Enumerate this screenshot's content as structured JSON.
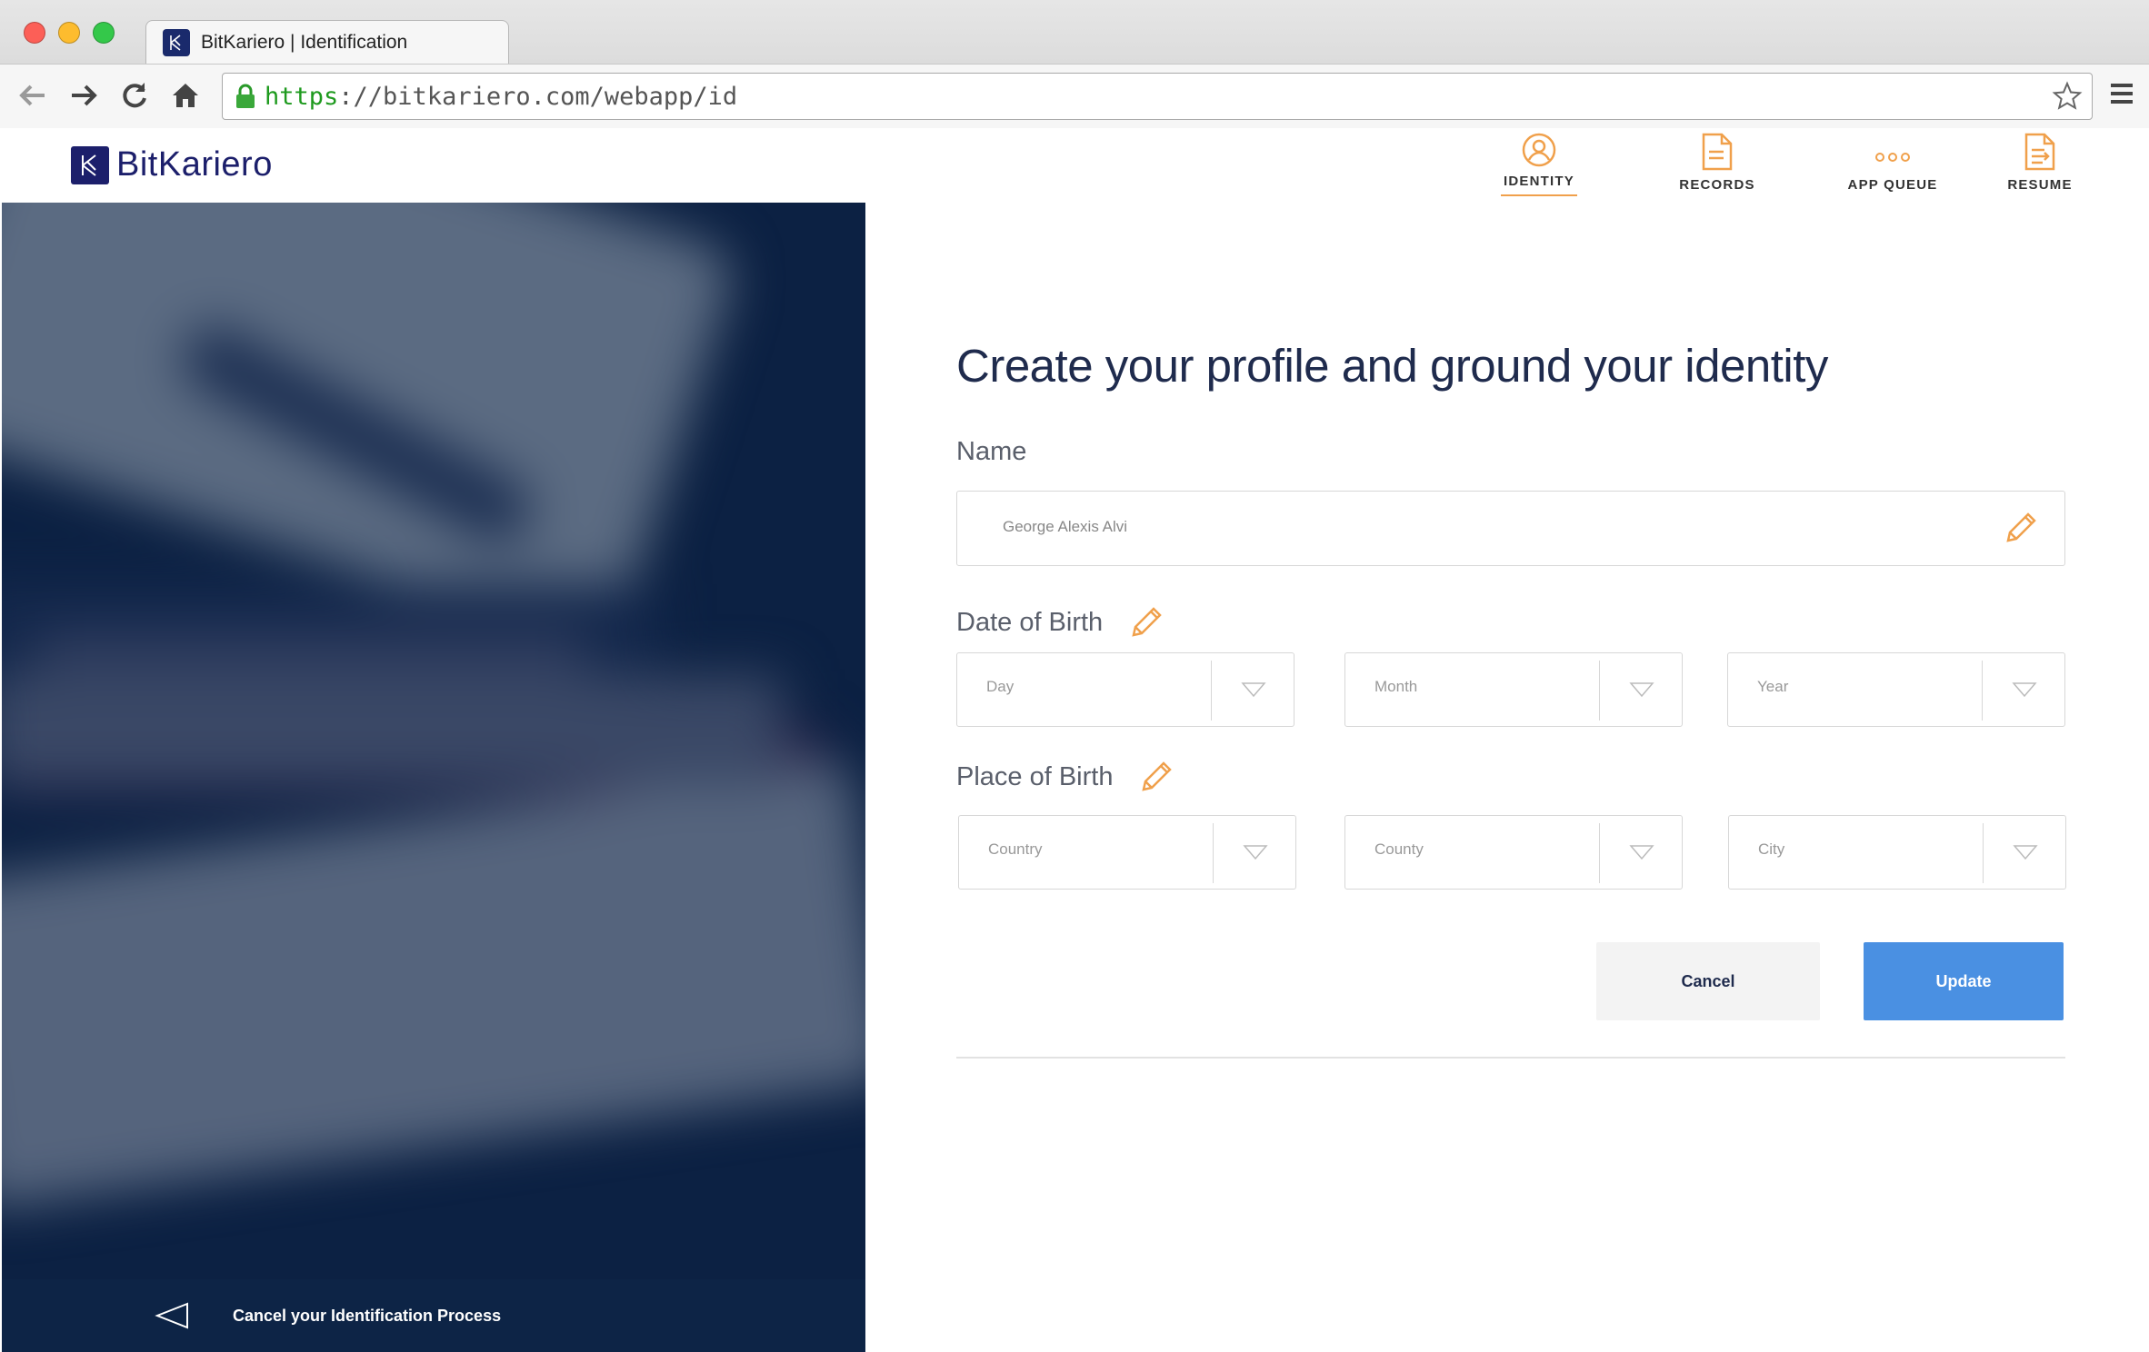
{
  "browser": {
    "tab_title": "BitKariero | Identification",
    "url_scheme": "https",
    "url_rest": "://bitkariero.com/webapp/id"
  },
  "app": {
    "logo_text": "BitKariero",
    "nav": [
      {
        "label": "IDENTITY",
        "icon": "user-circle-icon",
        "active": true
      },
      {
        "label": "RECORDS",
        "icon": "document-icon",
        "active": false
      },
      {
        "label": "APP QUEUE",
        "icon": "ellipsis-icon",
        "active": false
      },
      {
        "label": "RESUME",
        "icon": "resume-export-icon",
        "active": false
      }
    ],
    "accent_color": "#f0a04b"
  },
  "form": {
    "headline": "Create your profile and ground your identity",
    "name_label": "Name",
    "name_value": "George Alexis Alvi",
    "dob_label": "Date of Birth",
    "dob_fields": [
      "Day",
      "Month",
      "Year"
    ],
    "pob_label": "Place of Birth",
    "pob_fields": [
      "Country",
      "County",
      "City"
    ],
    "cancel_label": "Cancel",
    "update_label": "Update",
    "update_color": "#4a90e2"
  },
  "left_panel": {
    "cancel_process_label": "Cancel your Identification Process"
  }
}
